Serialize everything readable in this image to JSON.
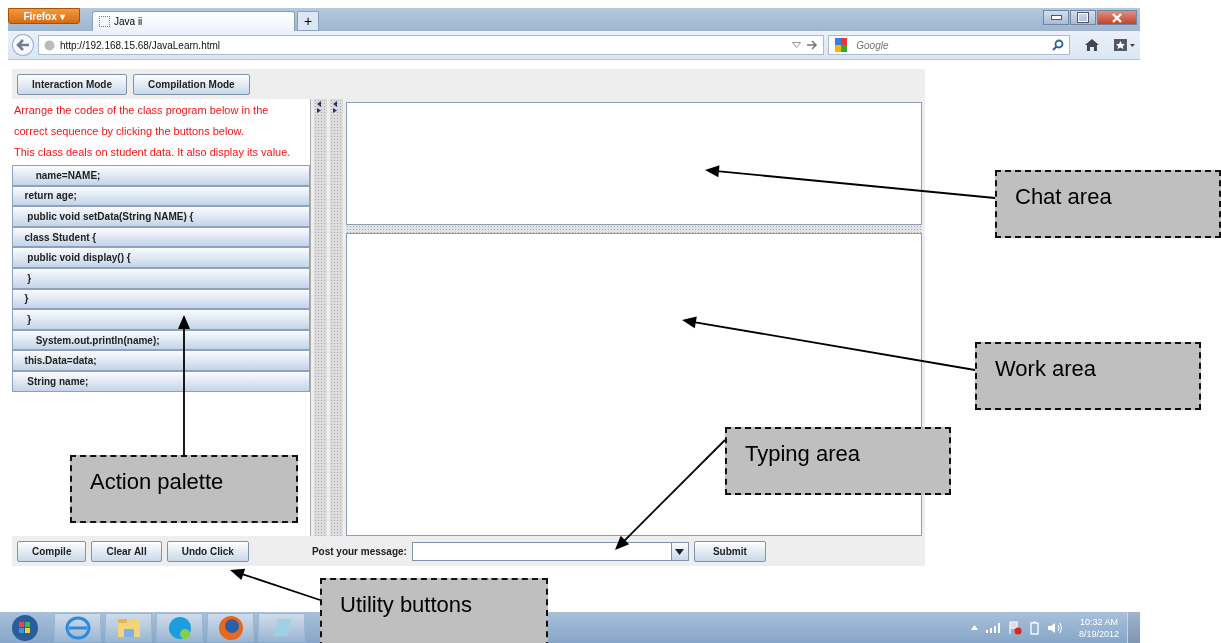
{
  "browser": {
    "menu_button": "Firefox ▾",
    "tab": {
      "title": "Java ii",
      "selected": true
    },
    "new_tab": "+",
    "url": "http://192.168.15.68/JavaLearn.html",
    "search": {
      "placeholder": "Google"
    }
  },
  "modes": [
    {
      "label": "Interaction Mode"
    },
    {
      "label": "Compilation Mode"
    }
  ],
  "instructions": [
    "Arrange the codes of the class program below in the",
    "correct sequence by clicking the buttons below.",
    "This class deals on student data. It also display its value."
  ],
  "code_buttons": [
    "      name=NAME;",
    "  return age;",
    "   public void setData(String NAME) {",
    "  class Student {",
    "   public void display() {",
    "   }",
    "  }",
    "   }",
    "      System.out.println(name);",
    "  this.Data=data;",
    "   String name;"
  ],
  "utility_buttons": [
    "Compile",
    "Clear All",
    "Undo Click"
  ],
  "message": {
    "label": "Post your message:",
    "submit": "Submit"
  },
  "callouts": [
    {
      "kind": "chat",
      "text": "Chat area"
    },
    {
      "kind": "work",
      "text": "Work area"
    },
    {
      "kind": "typing",
      "text": "Typing area"
    },
    {
      "kind": "palette",
      "text": "Action palette"
    },
    {
      "kind": "utility",
      "text": "Utility buttons"
    }
  ],
  "taskbar": {
    "time": "10:32 AM",
    "date": "8/19/2012"
  }
}
